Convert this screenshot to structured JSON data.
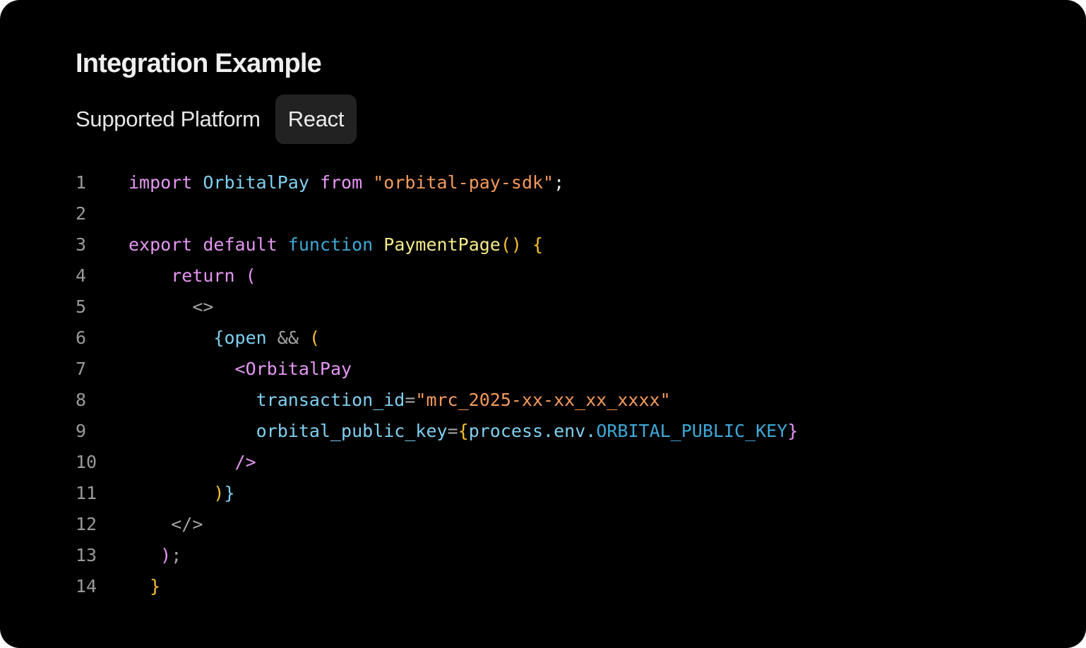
{
  "title": "Integration Example",
  "platform": {
    "label": "Supported Platform",
    "chip": "React"
  },
  "colors": {
    "background": "#000000",
    "chip_background": "#222222",
    "keyword": "#e596f2",
    "identifier": "#7fd0f0",
    "string": "#f49a5a",
    "function_name": "#f5ea8c",
    "bracket": "#f5c030",
    "builtin": "#3fa8d6",
    "line_number": "#9a9a9a"
  },
  "code": {
    "line_numbers": [
      "1",
      "2",
      "3",
      "4",
      "5",
      "6",
      "7",
      "8",
      "9",
      "10",
      "11",
      "12",
      "13",
      "14"
    ],
    "l1": {
      "import": "import",
      "name": "OrbitalPay",
      "from": "from",
      "module": "\"orbital-pay-sdk\"",
      "semi": ";"
    },
    "l3": {
      "export": "export",
      "default": "default",
      "function": "function",
      "name": "PaymentPage",
      "parens": "()",
      "brace": "{"
    },
    "l4": {
      "return": "return",
      "paren": "("
    },
    "l5": {
      "fragment_open": "<>"
    },
    "l6": {
      "brace": "{",
      "var": "open",
      "op": "&&",
      "paren": "("
    },
    "l7": {
      "tag": "<OrbitalPay"
    },
    "l8": {
      "attr": "transaction_id",
      "eq": "=",
      "value": "\"mrc_2025-xx-xx_xx_xxxx\""
    },
    "l9": {
      "attr": "orbital_public_key",
      "eq": "=",
      "brace_open": "{",
      "expr": "process.env.",
      "env_key": "ORBITAL_PUBLIC_KEY",
      "brace_close": "}"
    },
    "l10": {
      "self_close": "/>"
    },
    "l11": {
      "paren": ")",
      "brace": "}"
    },
    "l12": {
      "fragment_close": "</>"
    },
    "l13": {
      "paren": ")",
      "semi": ";"
    },
    "l14": {
      "brace": "}"
    }
  }
}
